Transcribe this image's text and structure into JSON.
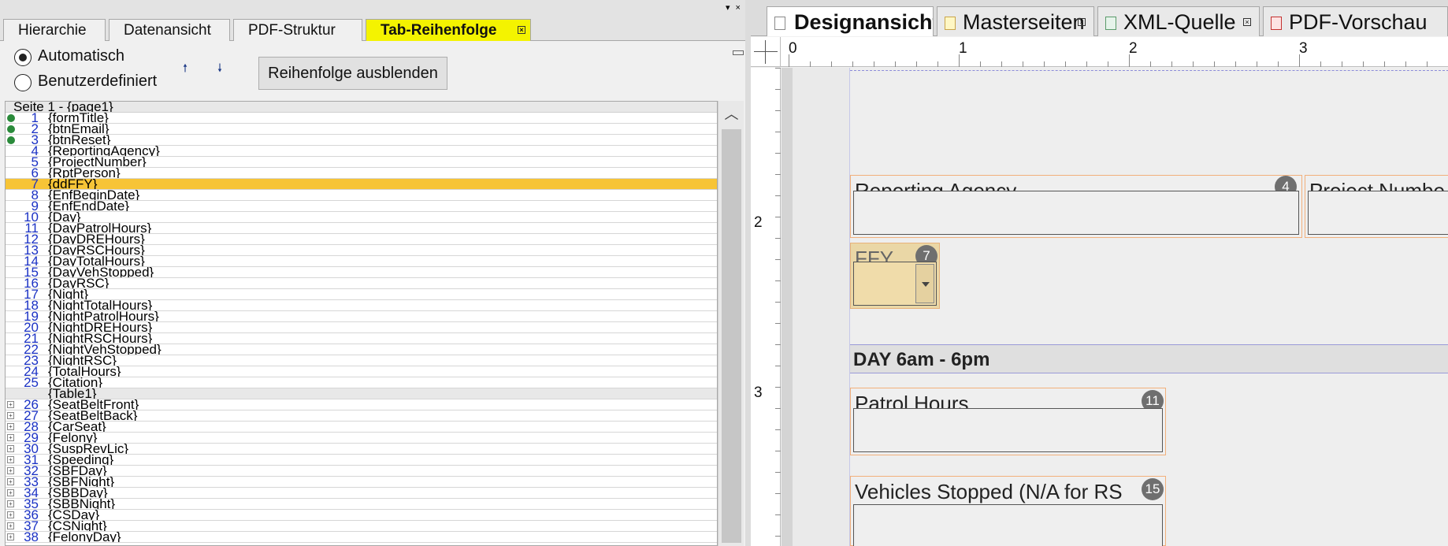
{
  "left_panel": {
    "tabs": [
      {
        "label": "Hierarchie"
      },
      {
        "label": "Datenansicht"
      },
      {
        "label": "PDF-Struktur"
      },
      {
        "label": "Tab-Reihenfolge"
      }
    ],
    "options": {
      "automatic_label": "Automatisch",
      "custom_label": "Benutzerdefiniert",
      "selected": "Automatisch"
    },
    "hide_order_button": "Reihenfolge ausblenden",
    "move_up_icon": "arrow-up",
    "move_down_icon": "arrow-down",
    "page_header": "Seite 1 - {page1}",
    "rows": [
      {
        "num": "1",
        "name": "{formTitle}",
        "marker": "green"
      },
      {
        "num": "2",
        "name": "{btnEmail}",
        "marker": "green"
      },
      {
        "num": "3",
        "name": "{btnReset}",
        "marker": "green"
      },
      {
        "num": "4",
        "name": "{ReportingAgency}"
      },
      {
        "num": "5",
        "name": "{ProjectNumber}"
      },
      {
        "num": "6",
        "name": "{RptPerson}"
      },
      {
        "num": "7",
        "name": "{ddFFY}",
        "highlight": true
      },
      {
        "num": "8",
        "name": "{EnfBeginDate}"
      },
      {
        "num": "9",
        "name": "{EnfEndDate}"
      },
      {
        "num": "10",
        "name": "{Day}"
      },
      {
        "num": "11",
        "name": "{DayPatrolHours}"
      },
      {
        "num": "12",
        "name": "{DayDREHours}"
      },
      {
        "num": "13",
        "name": "{DayRSCHours}"
      },
      {
        "num": "14",
        "name": "{DayTotalHours}"
      },
      {
        "num": "15",
        "name": "{DayVehStopped}"
      },
      {
        "num": "16",
        "name": "{DayRSC}"
      },
      {
        "num": "17",
        "name": "{Night}"
      },
      {
        "num": "18",
        "name": "{NightTotalHours}"
      },
      {
        "num": "19",
        "name": "{NightPatrolHours}"
      },
      {
        "num": "20",
        "name": "{NightDREHours}"
      },
      {
        "num": "21",
        "name": "{NightRSCHours}"
      },
      {
        "num": "22",
        "name": "{NightVehStopped}"
      },
      {
        "num": "23",
        "name": "{NightRSC}"
      },
      {
        "num": "24",
        "name": "{TotalHours}"
      },
      {
        "num": "25",
        "name": "{Citation}"
      },
      {
        "num": "",
        "name": "{Table1}",
        "group": true
      },
      {
        "num": "26",
        "name": "{SeatBeltFront}",
        "expander": true
      },
      {
        "num": "27",
        "name": "{SeatBeltBack}",
        "expander": true
      },
      {
        "num": "28",
        "name": "{CarSeat}",
        "expander": true
      },
      {
        "num": "29",
        "name": "{Felony}",
        "expander": true
      },
      {
        "num": "30",
        "name": "{SuspRevLic}",
        "expander": true
      },
      {
        "num": "31",
        "name": "{Speeding}",
        "expander": true
      },
      {
        "num": "32",
        "name": "{SBFDay}",
        "expander": true
      },
      {
        "num": "33",
        "name": "{SBFNight}",
        "expander": true
      },
      {
        "num": "34",
        "name": "{SBBDay}",
        "expander": true
      },
      {
        "num": "35",
        "name": "{SBBNight}",
        "expander": true
      },
      {
        "num": "36",
        "name": "{CSDay}",
        "expander": true
      },
      {
        "num": "37",
        "name": "{CSNight}",
        "expander": true
      },
      {
        "num": "38",
        "name": "{FelonyDay}",
        "expander": true
      }
    ]
  },
  "right_panel": {
    "tabs": [
      {
        "label": "Designansicht",
        "icon": "design-icon"
      },
      {
        "label": "Masterseiten",
        "icon": "page-icon"
      },
      {
        "label": "XML-Quelle",
        "icon": "xml-icon"
      },
      {
        "label": "PDF-Vorschau",
        "icon": "pdf-icon"
      }
    ],
    "ruler_h_labels": [
      "0",
      "1",
      "2",
      "3"
    ],
    "ruler_v_labels": [
      "2",
      "3"
    ],
    "fields": {
      "reporting_agency": {
        "label": "Reporting Agency",
        "badge": "4"
      },
      "project_number": {
        "label": "Project Numbe"
      },
      "ffy": {
        "label": "FFY",
        "badge": "7"
      },
      "patrol_hours": {
        "label": "Patrol Hours",
        "badge": "11"
      },
      "vehicles_stopped": {
        "label": "Vehicles Stopped (N/A for RS",
        "badge": "15"
      }
    },
    "day_section_title": "DAY 6am - 6pm"
  },
  "colors": {
    "active_left_tab": "#f4f300",
    "highlight_row": "#f7c436",
    "field_border": "#f2b07b",
    "ffy_fill": "#ead7a6",
    "badge": "#6f6f6f",
    "tab_number": "#1b32c4"
  }
}
